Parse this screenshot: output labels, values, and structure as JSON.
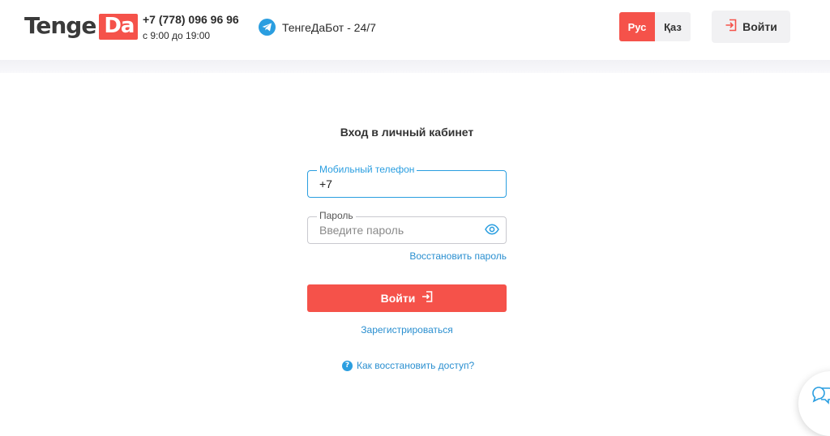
{
  "header": {
    "logo": {
      "part1": "Tenge",
      "part2": "Da"
    },
    "phone": {
      "number": "+7 (778) 096 96 96",
      "hours": "с 9:00 до 19:00"
    },
    "telegram_bot": {
      "label": "ТенгеДаБот - 24/7",
      "icon": "telegram-icon"
    },
    "languages": [
      {
        "label": "Рус",
        "active": true
      },
      {
        "label": "Қаз",
        "active": false
      }
    ],
    "login_button": {
      "label": "Войти",
      "icon": "login-icon"
    }
  },
  "form": {
    "title": "Вход в личный кабинет",
    "phone_field": {
      "legend": "Мобильный телефон",
      "value": "+7"
    },
    "password_field": {
      "legend": "Пароль",
      "placeholder": "Введите пароль",
      "icon": "eye-icon"
    },
    "restore_password": "Восстановить пароль",
    "submit": {
      "label": "Войти",
      "icon": "login-icon"
    },
    "register": "Зарегистрироваться",
    "help": {
      "label": "Как восстановить доступ?",
      "icon": "question-icon",
      "icon_glyph": "?"
    }
  },
  "colors": {
    "brand_red": "#f5524a",
    "accent_blue": "#2a9ee0",
    "text_dark": "#333333"
  }
}
